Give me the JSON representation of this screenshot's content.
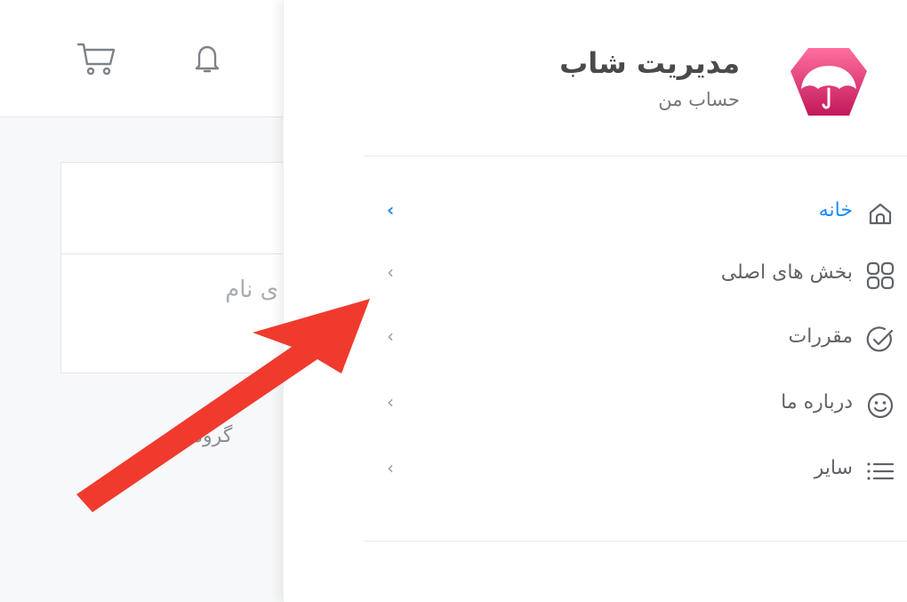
{
  "brand": {
    "title": "مدیریت شاب",
    "subtitle": "حساب من",
    "logo_icon": "umbrella-logo-icon",
    "logo_color": "#e23a7a"
  },
  "menu": {
    "items": [
      {
        "label": "خانه",
        "icon": "home-icon",
        "active": true
      },
      {
        "label": "بخش های اصلی",
        "icon": "grid-icon",
        "active": false
      },
      {
        "label": "مقررات",
        "icon": "check-circle-icon",
        "active": false
      },
      {
        "label": "درباره ما",
        "icon": "smile-icon",
        "active": false
      },
      {
        "label": "سایر",
        "icon": "list-icon",
        "active": false
      }
    ],
    "chevron": "‹",
    "active_color": "#1a8cff"
  },
  "background_page": {
    "field_label": "ی نام",
    "group_label": "گروه‌ه",
    "icons": [
      "cart-icon",
      "bell-icon"
    ]
  },
  "annotation": {
    "color": "#f03a2e"
  }
}
